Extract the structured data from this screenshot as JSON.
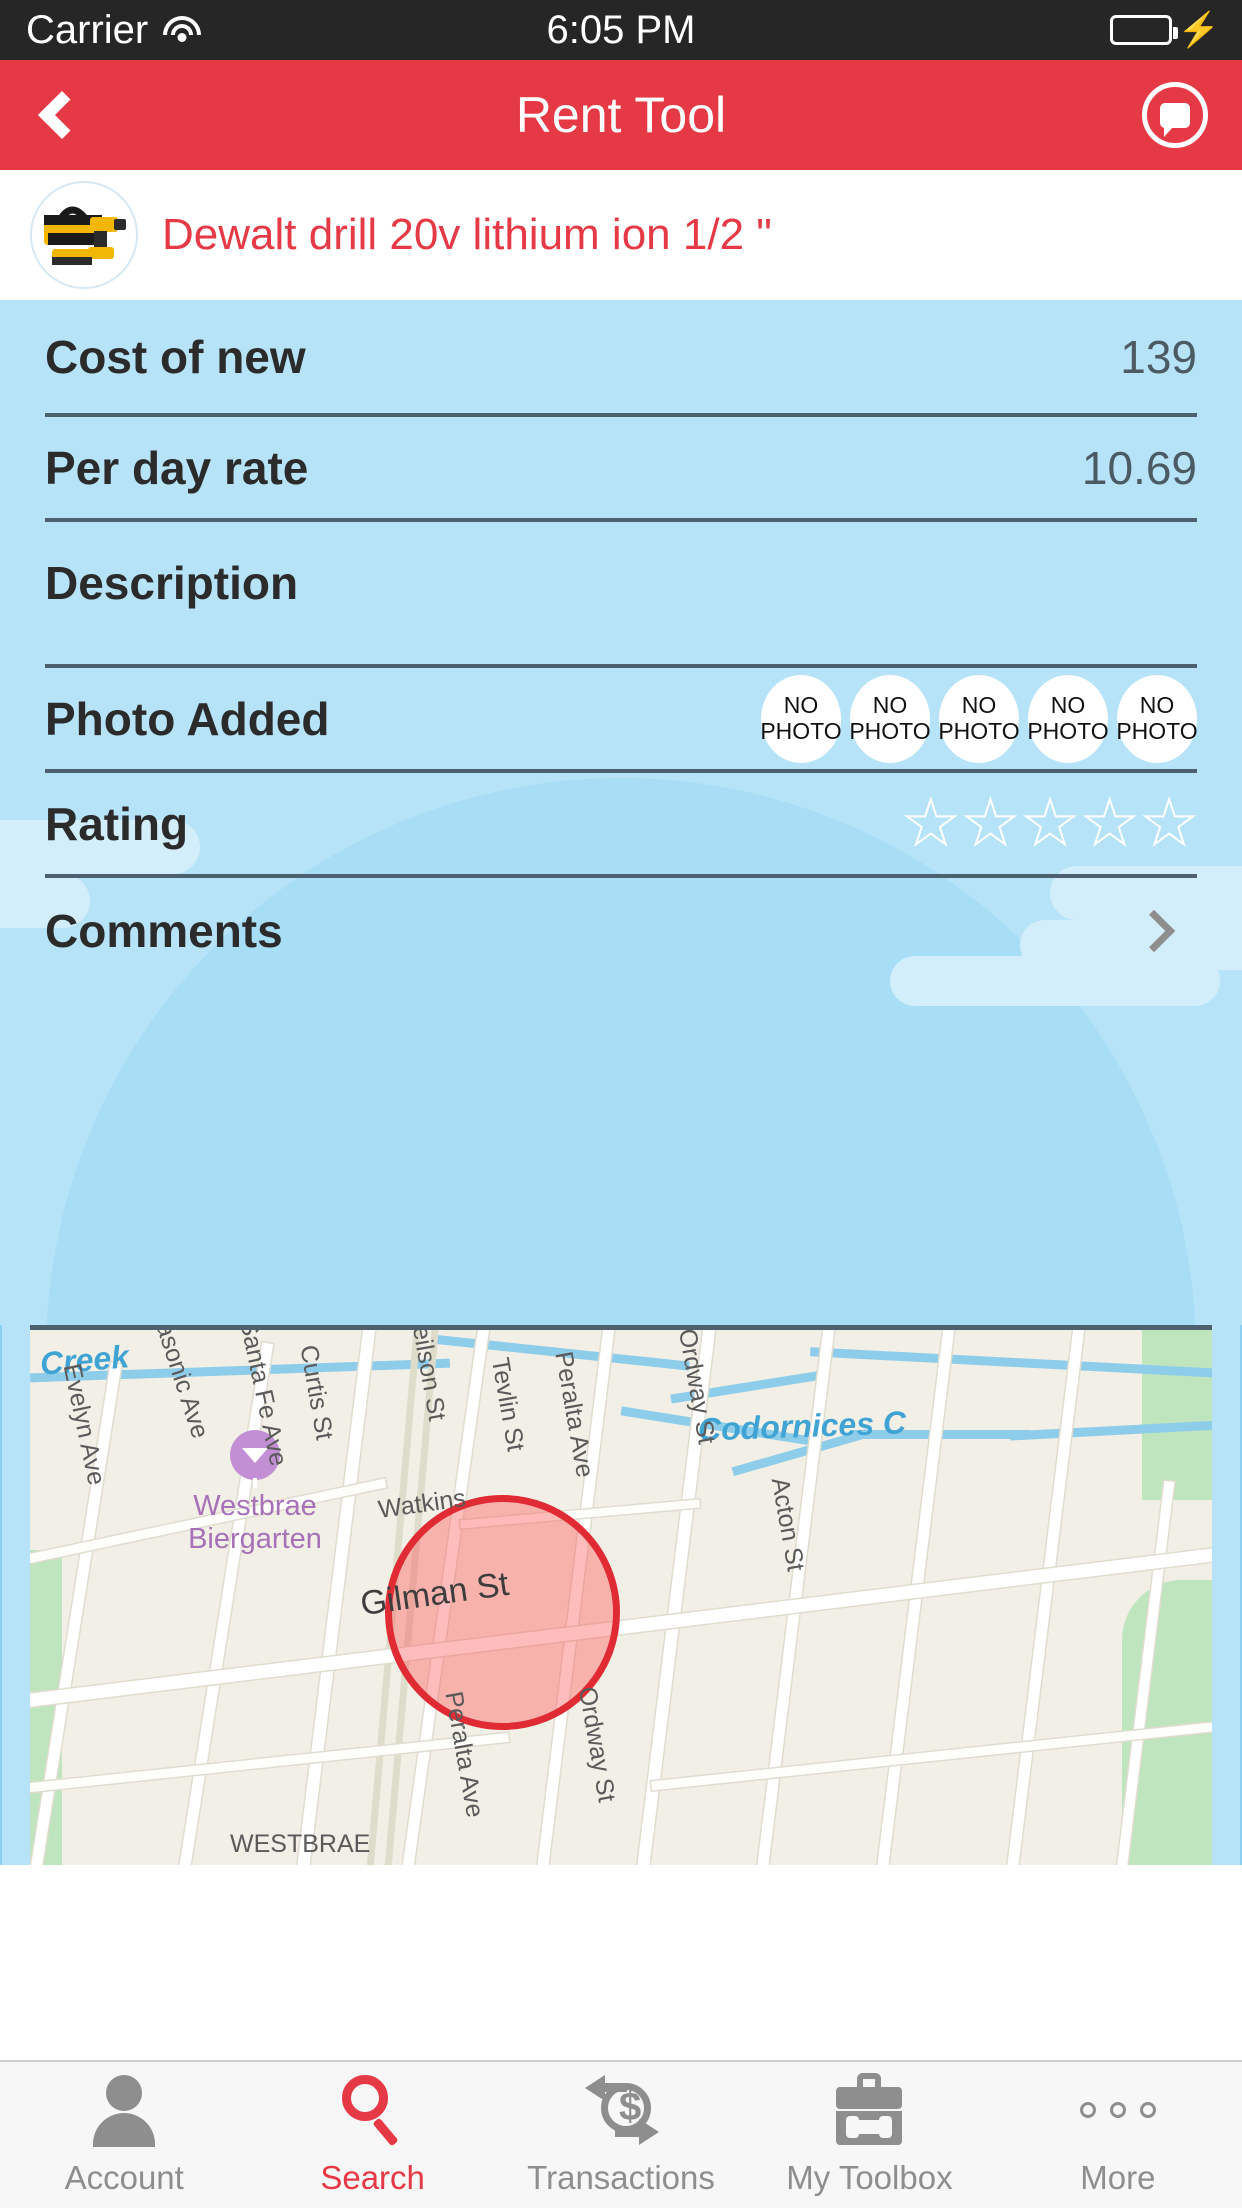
{
  "status_bar": {
    "carrier": "Carrier",
    "time": "6:05 PM",
    "wifi_icon": "wifi-icon",
    "battery_icon": "battery-icon",
    "charging_icon": "lightning-bolt-icon",
    "battery_color": "#44D544"
  },
  "nav": {
    "back_icon": "chevron-left-icon",
    "title": "Rent Tool",
    "chat_icon": "chat-bubble-icon",
    "bar_color": "#E63946"
  },
  "tool": {
    "name": "Dewalt drill 20v lithium ion 1/2 \"",
    "avatar_icon": "tool-thumbnail-drill",
    "name_color": "#E63946"
  },
  "details": {
    "panel_color": "#B7E3F8",
    "rows": [
      {
        "label": "Cost of new",
        "value": "139"
      },
      {
        "label": "Per day rate",
        "value": "10.69"
      },
      {
        "label": "Description",
        "value": ""
      },
      {
        "label": "Photo Added",
        "value": ""
      },
      {
        "label": "Rating",
        "value": ""
      },
      {
        "label": "Comments",
        "value": ""
      }
    ],
    "photo_placeholder_line1": "NO",
    "photo_placeholder_line2": "PHOTO",
    "photo_count": 5,
    "rating_stars_total": 5,
    "rating_stars_filled": 0,
    "comments_chevron_icon": "chevron-right-icon"
  },
  "map": {
    "marker_color": "#E02B34",
    "street_labels": [
      "Evelyn Ave",
      "Masonic Ave",
      "Santa Fe Ave",
      "Curtis St",
      "Neilson St",
      "Watkins",
      "Tevlin St",
      "Peralta Ave",
      "Ordway St",
      "Acton St",
      "Gilman St",
      "Peralta Ave",
      "Ordway St"
    ],
    "water_labels": [
      "Creek",
      "Codornices C"
    ],
    "poi": {
      "name_line1": "Westbrae",
      "name_line2": "Biergarten",
      "icon": "cocktail-glass-icon"
    },
    "area_label": "WESTBRAE"
  },
  "tabs": [
    {
      "label": "Account",
      "icon": "person-icon",
      "active": false
    },
    {
      "label": "Search",
      "icon": "magnifier-icon",
      "active": true
    },
    {
      "label": "Transactions",
      "icon": "exchange-dollar-icon",
      "active": false
    },
    {
      "label": "My Toolbox",
      "icon": "toolbox-icon",
      "active": false
    },
    {
      "label": "More",
      "icon": "ellipsis-icon",
      "active": false
    }
  ]
}
